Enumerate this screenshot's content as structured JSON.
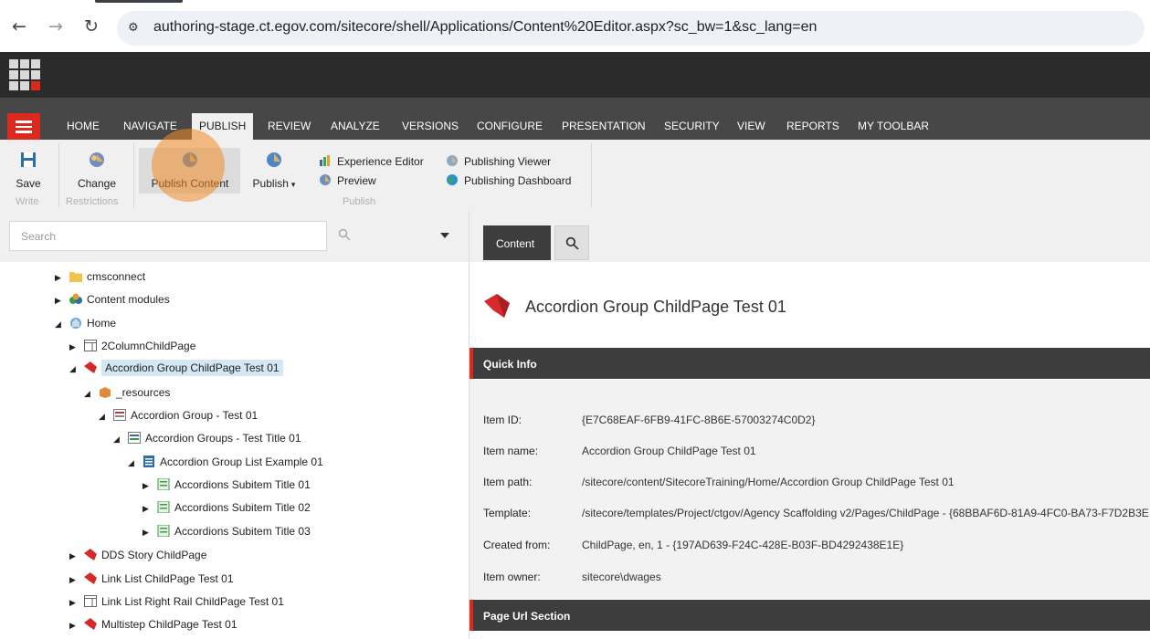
{
  "browser": {
    "url": "authoring-stage.ct.egov.com/sitecore/shell/Applications/Content%20Editor.aspx?sc_bw=1&sc_lang=en",
    "back_icon": "arrow-left-icon",
    "forward_icon": "arrow-right-icon",
    "reload_icon": "reload-icon"
  },
  "ribbon_tabs": [
    {
      "label": "HOME"
    },
    {
      "label": "NAVIGATE"
    },
    {
      "label": "PUBLISH"
    },
    {
      "label": "REVIEW"
    },
    {
      "label": "ANALYZE"
    },
    {
      "label": "VERSIONS"
    },
    {
      "label": "CONFIGURE"
    },
    {
      "label": "PRESENTATION"
    },
    {
      "label": "SECURITY"
    },
    {
      "label": "VIEW"
    },
    {
      "label": "REPORTS"
    },
    {
      "label": "MY TOOLBAR"
    }
  ],
  "active_tab": "PUBLISH",
  "ribbon": {
    "save_label": "Save",
    "write_group": "Write",
    "change_label": "Change",
    "restrictions_group": "Restrictions",
    "publish_content_label": "Publish Content",
    "publish_label": "Publish",
    "experience_editor_label": "Experience Editor",
    "preview_label": "Preview",
    "publishing_viewer_label": "Publishing Viewer",
    "publishing_dashboard_label": "Publishing Dashboard",
    "publish_group": "Publish"
  },
  "search": {
    "placeholder": "Search"
  },
  "tree": [
    {
      "label": "cmsconnect",
      "expanded": false
    },
    {
      "label": "Content modules",
      "expanded": false
    },
    {
      "label": "Home",
      "expanded": true
    },
    {
      "label": "2ColumnChildPage",
      "expanded": false
    },
    {
      "label": "Accordion Group ChildPage Test 01",
      "expanded": true,
      "selected": true
    },
    {
      "label": "_resources",
      "expanded": true
    },
    {
      "label": "Accordion Group - Test 01",
      "expanded": true
    },
    {
      "label": "Accordion Groups - Test Title 01",
      "expanded": true
    },
    {
      "label": "Accordion Group List Example 01",
      "expanded": true
    },
    {
      "label": "Accordions Subitem Title 01",
      "expanded": false
    },
    {
      "label": "Accordions Subitem Title 02",
      "expanded": false
    },
    {
      "label": "Accordions Subitem Title 03",
      "expanded": false
    },
    {
      "label": "DDS Story ChildPage",
      "expanded": false
    },
    {
      "label": "Link List ChildPage Test 01",
      "expanded": false
    },
    {
      "label": "Link List Right Rail ChildPage Test 01",
      "expanded": false
    },
    {
      "label": "Multistep ChildPage Test 01",
      "expanded": false
    }
  ],
  "content_tab": {
    "label": "Content"
  },
  "item": {
    "title": "Accordion Group ChildPage Test 01"
  },
  "quick_info": {
    "header": "Quick Info",
    "rows": [
      {
        "key": "Item ID:",
        "value": "{E7C68EAF-6FB9-41FC-8B6E-57003274C0D2}"
      },
      {
        "key": "Item name:",
        "value": "Accordion Group ChildPage Test 01"
      },
      {
        "key": "Item path:",
        "value": "/sitecore/content/SitecoreTraining/Home/Accordion Group ChildPage Test 01"
      },
      {
        "key": "Template:",
        "value": "/sitecore/templates/Project/ctgov/Agency Scaffolding v2/Pages/ChildPage - {68BBAF6D-81A9-4FC0-BA73-F7D2B3E"
      },
      {
        "key": "Created from:",
        "value": "ChildPage, en, 1 - {197AD639-F24C-428E-B03F-BD4292438E1E}"
      },
      {
        "key": "Item owner:",
        "value": "sitecore\\dwages"
      }
    ]
  },
  "page_url_section": {
    "header": "Page Url Section"
  }
}
